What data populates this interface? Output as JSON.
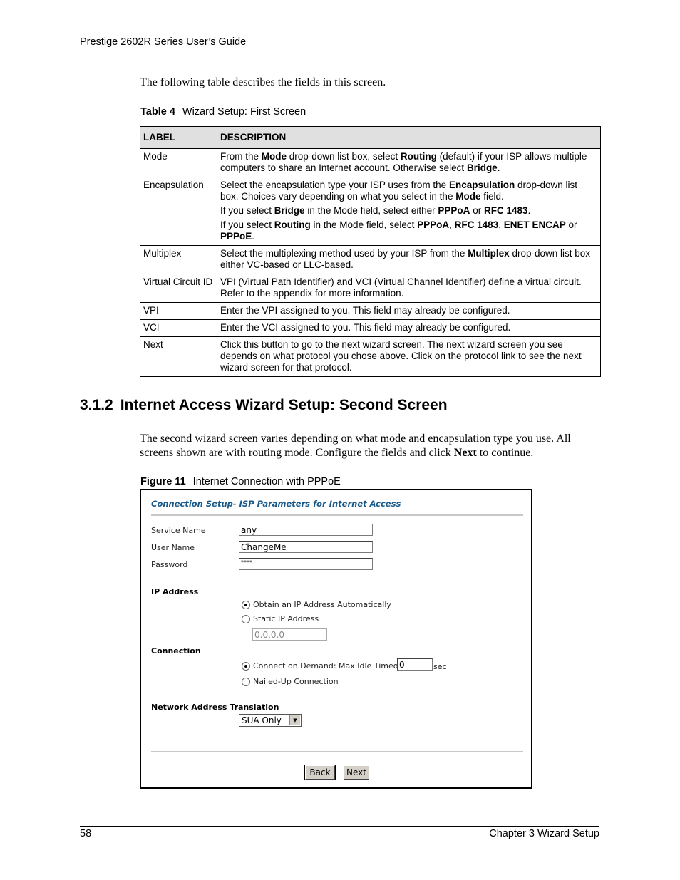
{
  "header": {
    "running_title": "Prestige 2602R Series User’s Guide"
  },
  "intro_text": "The following table describes the fields in this screen.",
  "table": {
    "caption_label": "Table 4",
    "caption_title": "Wizard Setup: First Screen",
    "columns": [
      "LABEL",
      "DESCRIPTION"
    ],
    "rows": [
      {
        "label": "Mode",
        "desc": [
          [
            {
              "t": "From the "
            },
            {
              "b": "Mode"
            },
            {
              "t": " drop-down list box, select "
            },
            {
              "b": "Routing"
            },
            {
              "t": " (default) if your ISP allows multiple computers to share an Internet account. Otherwise select "
            },
            {
              "b": "Bridge"
            },
            {
              "t": "."
            }
          ]
        ]
      },
      {
        "label": "Encapsulation",
        "desc": [
          [
            {
              "t": "Select the encapsulation type your ISP uses from the "
            },
            {
              "b": "Encapsulation"
            },
            {
              "t": " drop-down list box. Choices vary depending on what you select in the "
            },
            {
              "b": "Mode"
            },
            {
              "t": " field."
            }
          ],
          [
            {
              "t": "If you select "
            },
            {
              "b": "Bridge"
            },
            {
              "t": " in the Mode field, select either "
            },
            {
              "b": "PPPoA"
            },
            {
              "t": " or "
            },
            {
              "b": "RFC 1483"
            },
            {
              "t": "."
            }
          ],
          [
            {
              "t": "If you select "
            },
            {
              "b": "Routing"
            },
            {
              "t": " in the Mode field, select "
            },
            {
              "b": "PPPoA"
            },
            {
              "t": ", "
            },
            {
              "b": "RFC 1483"
            },
            {
              "t": ", "
            },
            {
              "b": "ENET ENCAP"
            },
            {
              "t": " or "
            },
            {
              "b": "PPPoE"
            },
            {
              "t": "."
            }
          ]
        ]
      },
      {
        "label": "Multiplex",
        "desc": [
          [
            {
              "t": "Select the multiplexing method used by your ISP from the "
            },
            {
              "b": "Multiplex"
            },
            {
              "t": " drop-down list box either VC-based or LLC-based."
            }
          ]
        ]
      },
      {
        "label": "Virtual Circuit ID",
        "desc": [
          [
            {
              "t": "VPI (Virtual Path Identifier) and VCI (Virtual Channel Identifier) define a virtual circuit. Refer to the appendix for more information."
            }
          ]
        ]
      },
      {
        "label": "VPI",
        "desc": [
          [
            {
              "t": "Enter the VPI assigned to you. This field may already be configured."
            }
          ]
        ]
      },
      {
        "label": "VCI",
        "desc": [
          [
            {
              "t": "Enter the VCI assigned to you. This field may already be configured."
            }
          ]
        ]
      },
      {
        "label": "Next",
        "desc": [
          [
            {
              "t": "Click this button to go to the next wizard screen. The next wizard screen you see depends on what protocol you chose above. Click on the protocol link to see the next wizard screen for that protocol."
            }
          ]
        ]
      }
    ]
  },
  "section": {
    "number": "3.1.2",
    "title": "Internet Access Wizard Setup: Second Screen",
    "para_before": "The second wizard screen varies depending on what mode and encapsulation type you use. All screens shown are with routing mode. Configure the fields and click ",
    "para_bold": "Next",
    "para_after": " to continue."
  },
  "figure": {
    "caption_label": "Figure 11",
    "caption_title": "Internet Connection with PPPoE",
    "screen_title": "Connection Setup- ISP Parameters for Internet Access",
    "title_color": "#1a5a8a",
    "fields": {
      "service_name": {
        "label": "Service Name",
        "value": "any"
      },
      "user_name": {
        "label": "User Name",
        "value": "ChangeMe"
      },
      "password": {
        "label": "Password",
        "value": "****"
      }
    },
    "ip_address": {
      "heading": "IP Address",
      "option_auto": "Obtain an IP Address Automatically",
      "option_static": "Static IP Address",
      "selected": "auto",
      "static_value": "0.0.0.0"
    },
    "connection": {
      "heading": "Connection",
      "option_demand": "Connect on Demand: Max Idle Timeout",
      "timeout_value": "0",
      "timeout_unit": "sec",
      "option_nailed": "Nailed-Up Connection",
      "selected": "demand"
    },
    "nat": {
      "heading": "Network Address Translation",
      "selected": "SUA Only"
    },
    "buttons": {
      "back": "Back",
      "next": "Next"
    }
  },
  "footer": {
    "page_number": "58",
    "chapter": "Chapter 3 Wizard Setup"
  }
}
